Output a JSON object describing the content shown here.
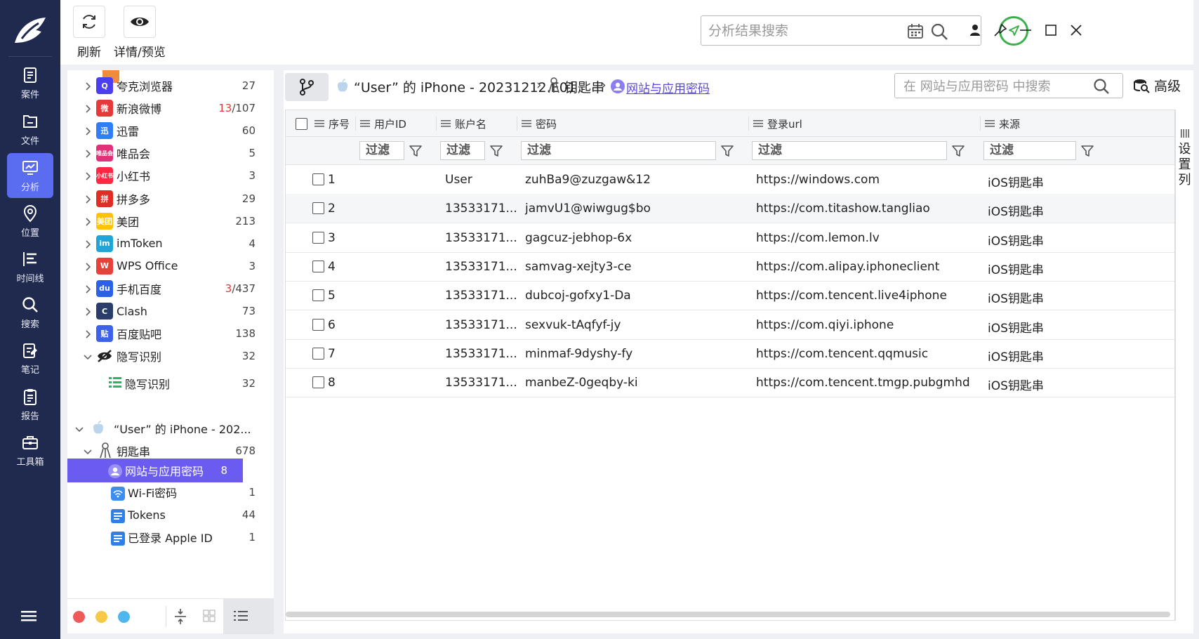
{
  "nav": {
    "items": [
      {
        "label": "案件",
        "icon": "case-icon"
      },
      {
        "label": "文件",
        "icon": "file-icon"
      },
      {
        "label": "分析",
        "icon": "analysis-icon",
        "active": true
      },
      {
        "label": "位置",
        "icon": "location-icon"
      },
      {
        "label": "时间线",
        "icon": "timeline-icon"
      },
      {
        "label": "搜索",
        "icon": "search-icon"
      },
      {
        "label": "笔记",
        "icon": "note-icon"
      },
      {
        "label": "报告",
        "icon": "report-icon"
      },
      {
        "label": "工具箱",
        "icon": "toolbox-icon"
      }
    ]
  },
  "toolbar": {
    "refresh_label": "刷新",
    "preview_label": "详情/预览",
    "search_placeholder": "分析结果搜索"
  },
  "tree": {
    "apps": [
      {
        "label": "夸克浏览器",
        "count": "27",
        "icon_text": "Q",
        "color": "#4b3df0"
      },
      {
        "label": "新浪微博",
        "count_red": "13",
        "count": "/107",
        "icon_text": "微",
        "color": "#e8393a"
      },
      {
        "label": "迅雷",
        "count": "60",
        "icon_text": "迅",
        "color": "#2f7ef6"
      },
      {
        "label": "唯品会",
        "count": "5",
        "icon_text": "唯品会",
        "color": "#e3307a"
      },
      {
        "label": "小红书",
        "count": "3",
        "icon_text": "小红书",
        "color": "#ff2741"
      },
      {
        "label": "拼多多",
        "count": "29",
        "icon_text": "拼",
        "color": "#e02e24"
      },
      {
        "label": "美团",
        "count": "213",
        "icon_text": "美团",
        "color": "#ffc300"
      },
      {
        "label": "imToken",
        "count": "4",
        "icon_text": "im",
        "color": "#1fa5d8"
      },
      {
        "label": "WPS Office",
        "count": "3",
        "icon_text": "W",
        "color": "#e8403a"
      },
      {
        "label": "手机百度",
        "count_red": "3",
        "count": "/437",
        "icon_text": "du",
        "color": "#2b60e8"
      },
      {
        "label": "Clash",
        "count": "73",
        "icon_text": "C",
        "color": "#2b3e6b"
      },
      {
        "label": "百度贴吧",
        "count": "138",
        "icon_text": "贴",
        "color": "#3b62e8"
      },
      {
        "label": "隐写识别",
        "count": "32",
        "icon_text": "",
        "color": "#222"
      }
    ],
    "stego_child": {
      "label": "隐写识别",
      "count": "32"
    },
    "device": {
      "label": "“User” 的 iPhone - 202..."
    },
    "keychain": {
      "label": "钥匙串",
      "count": "678"
    },
    "keychain_children": [
      {
        "label": "网站与应用密码",
        "count": "8",
        "selected": true
      },
      {
        "label": "Wi-Fi密码",
        "count": "1"
      },
      {
        "label": "Tokens",
        "count": "44"
      },
      {
        "label": "已登录 Apple ID",
        "count": "1"
      }
    ]
  },
  "breadcrumb": {
    "device": "“User” 的 iPhone - 20231212.E01",
    "keychain": "钥匙串",
    "current": "网站与应用密码"
  },
  "local_search": {
    "placeholder": "在 网站与应用密码 中搜索"
  },
  "advanced_label": "高级",
  "columns": [
    "序号",
    "用户ID",
    "账户名",
    "密码",
    "登录url",
    "来源"
  ],
  "filter_label": "过滤",
  "set_columns_label": [
    "设",
    "置",
    "列"
  ],
  "rows": [
    {
      "idx": "1",
      "user_id": "",
      "account": "User",
      "password": "zuhBa9@zuzgaw&12",
      "url": "https://windows.com",
      "source": "iOS钥匙串"
    },
    {
      "idx": "2",
      "user_id": "",
      "account": "13533171...",
      "password": "jamvU1@wiwgug$bo",
      "url": "https://com.titashow.tangliao",
      "source": "iOS钥匙串"
    },
    {
      "idx": "3",
      "user_id": "",
      "account": "13533171...",
      "password": "gagcuz-jebhop-6x",
      "url": "https://com.lemon.lv",
      "source": "iOS钥匙串"
    },
    {
      "idx": "4",
      "user_id": "",
      "account": "13533171...",
      "password": "samvag-xejty3-ce",
      "url": "https://com.alipay.iphoneclient",
      "source": "iOS钥匙串"
    },
    {
      "idx": "5",
      "user_id": "",
      "account": "13533171...",
      "password": "dubcoj-gofxy1-Da",
      "url": "https://com.tencent.live4iphone",
      "source": "iOS钥匙串"
    },
    {
      "idx": "6",
      "user_id": "",
      "account": "13533171...",
      "password": "sexvuk-tAqfyf-jy",
      "url": "https://com.qiyi.iphone",
      "source": "iOS钥匙串"
    },
    {
      "idx": "7",
      "user_id": "",
      "account": "13533171...",
      "password": "minmaf-9dyshy-fy",
      "url": "https://com.tencent.qqmusic",
      "source": "iOS钥匙串"
    },
    {
      "idx": "8",
      "user_id": "",
      "account": "13533171...",
      "password": "manbeZ-0geqby-ki",
      "url": "https://com.tencent.tmgp.pubgmhd",
      "source": "iOS钥匙串"
    }
  ],
  "colors": {
    "nav_bg": "#1f2a4e",
    "accent": "#5a6cf0",
    "selected": "#6c5bf0",
    "green": "#3db04b"
  }
}
